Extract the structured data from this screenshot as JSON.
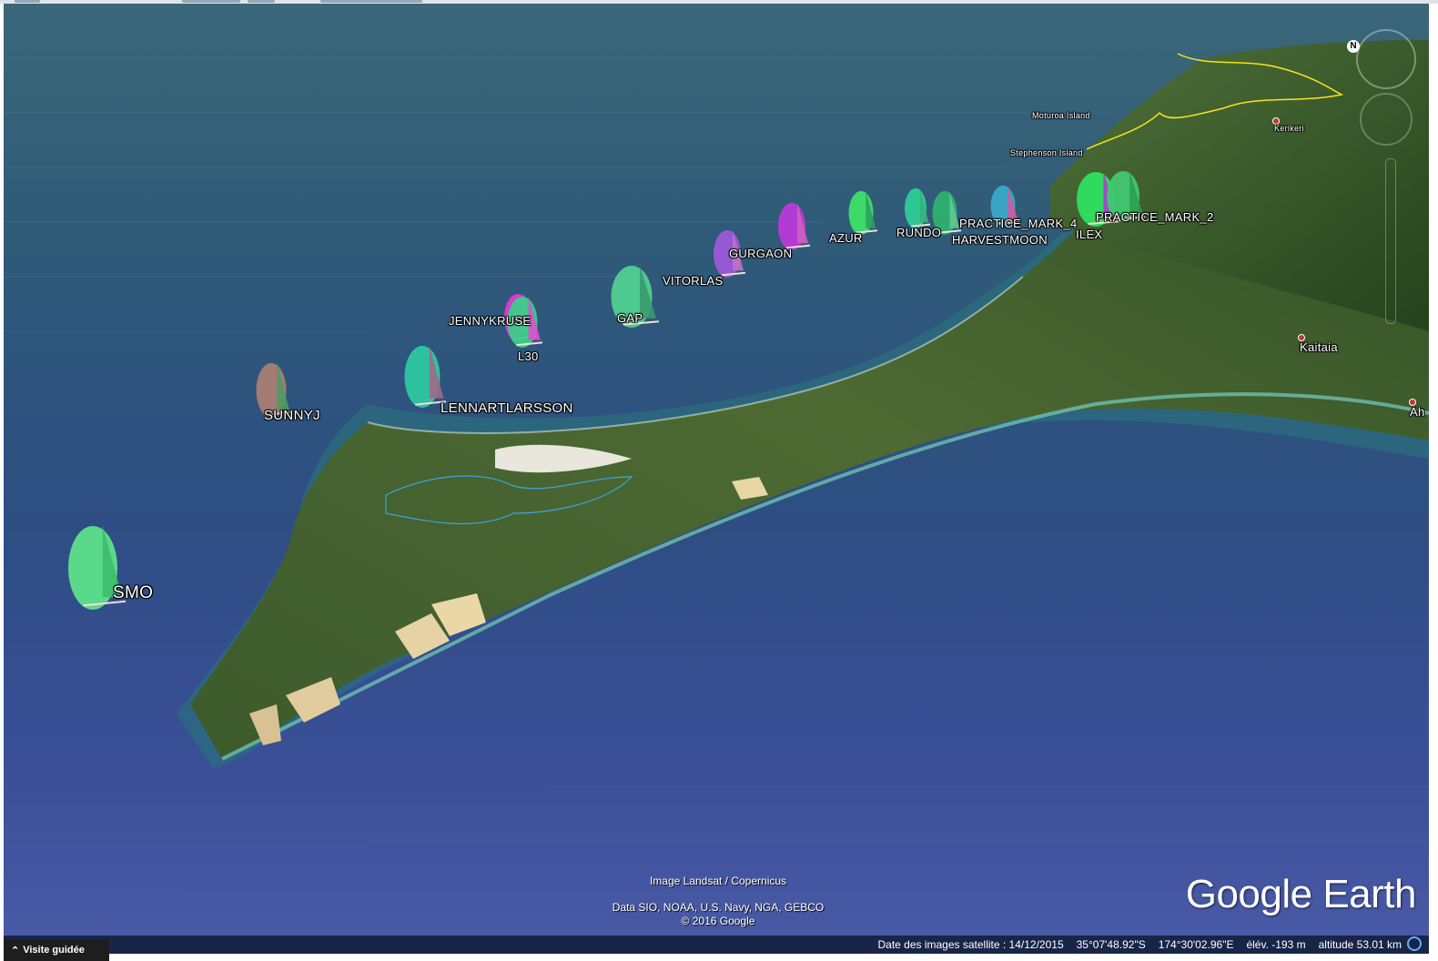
{
  "map": {
    "places": [
      {
        "name": "Kerikeri",
        "kind": "town"
      },
      {
        "name": "Kaitaia",
        "kind": "town"
      },
      {
        "name": "Ah",
        "kind": "town"
      },
      {
        "name": "Moturoa Island",
        "kind": "island"
      },
      {
        "name": "Stephenson Island",
        "kind": "island"
      }
    ],
    "boats": [
      {
        "name": "SMO",
        "colors": [
          "#5ee08a",
          "#3bbd6a"
        ]
      },
      {
        "name": "SUNNYJ",
        "colors": [
          "#a87d74",
          "#4f9a5f"
        ]
      },
      {
        "name": "LENNARTLARSSON",
        "colors": [
          "#2ec7a2",
          "#a06a8a"
        ]
      },
      {
        "name": "JENNYKRUSE",
        "colors": [
          "#e03ad0",
          "#3ed88f"
        ]
      },
      {
        "name": "L30",
        "colors": [
          "#3ecb8a",
          "#e04fcf"
        ]
      },
      {
        "name": "GAP",
        "colors": [
          "#50d090",
          "#3a9a70"
        ]
      },
      {
        "name": "VITORLAS",
        "colors": [
          "#9a5ad8",
          "#c070c8"
        ]
      },
      {
        "name": "GURGAON",
        "colors": [
          "#b83ad8",
          "#d060c0"
        ]
      },
      {
        "name": "AZUR",
        "colors": [
          "#3ee06a",
          "#2aa060"
        ]
      },
      {
        "name": "RUNDO",
        "colors": [
          "#2ecc98",
          "#38b07a"
        ]
      },
      {
        "name": "HARVESTMOON",
        "colors": [
          "#2fb070",
          "#60c890"
        ]
      },
      {
        "name": "PRACTICE_MARK_4",
        "colors": [
          "#3aa8c8",
          "#d05aa0"
        ]
      },
      {
        "name": "ILEX",
        "colors": [
          "#2ee060",
          "#b03ad8"
        ]
      },
      {
        "name": "PRACTICE_MARK_2",
        "colors": [
          "#40c870",
          "#2ea050"
        ]
      }
    ]
  },
  "attribution": {
    "imagery": "Image Landsat / Copernicus",
    "data": "Data SIO, NOAA, U.S. Navy, NGA, GEBCO",
    "copyright": "© 2016 Google"
  },
  "brand": "Google Earth",
  "status": {
    "tour_label": "Visite guidée",
    "imagery_date": "Date des images satellite : 14/12/2015",
    "lat": "35°07'48.92\"S",
    "lon": "174°30'02.96\"E",
    "elevation": "élév. -193 m",
    "altitude": "altitude  53.01 km"
  },
  "nav": {
    "north": "N"
  }
}
